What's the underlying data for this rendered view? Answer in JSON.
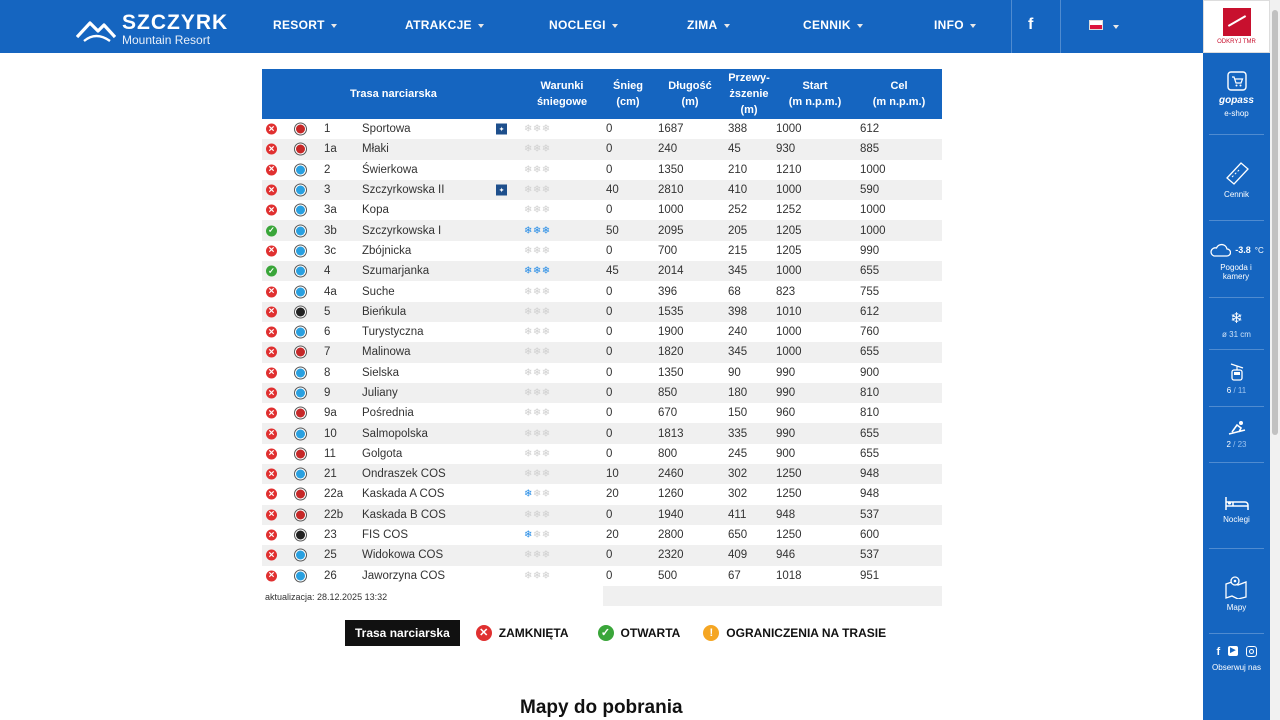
{
  "brand": {
    "title": "SZCZYRK",
    "subtitle": "Mountain Resort"
  },
  "nav": [
    "RESORT",
    "ATRAKCJE",
    "NOCLEGI",
    "ZIMA",
    "CENNIK",
    "INFO"
  ],
  "sidebar": {
    "brand_caption": "ODKRYJ TMR",
    "gopass": {
      "logo": "gopass",
      "label": "e-shop"
    },
    "cennik": "Cennik",
    "weather": {
      "temp": "-3.8",
      "unit": "°C",
      "label": "Pogoda i kamery"
    },
    "snow": "ø 31 cm",
    "lifts": {
      "open": "6",
      "total": "11"
    },
    "slopes": {
      "open": "2",
      "total": "23"
    },
    "noclegi": "Noclegi",
    "mapy": "Mapy",
    "follow": "Obserwuj nas"
  },
  "table": {
    "headers": {
      "trail": "Trasa narciarska",
      "conditions_1": "Warunki",
      "conditions_2": "śniegowe",
      "snow_1": "Śnieg",
      "snow_2": "(cm)",
      "length_1": "Długość",
      "length_2": "(m)",
      "drop_1": "Przewy-",
      "drop_2": "ższenie",
      "drop_3": "(m)",
      "start_1": "Start",
      "start_2": "(m n.p.m.)",
      "end_1": "Cel",
      "end_2": "(m n.p.m.)"
    },
    "rows": [
      {
        "status": "closed",
        "difficulty": "red",
        "num": "1",
        "name": "Sportowa",
        "lamp": true,
        "flakes": 0,
        "snow": "0",
        "length": "1687",
        "drop": "388",
        "start": "1000",
        "end": "612"
      },
      {
        "status": "closed",
        "difficulty": "red",
        "num": "1a",
        "name": "Młaki",
        "lamp": false,
        "flakes": 0,
        "snow": "0",
        "length": "240",
        "drop": "45",
        "start": "930",
        "end": "885"
      },
      {
        "status": "closed",
        "difficulty": "blue",
        "num": "2",
        "name": "Świerkowa",
        "lamp": false,
        "flakes": 0,
        "snow": "0",
        "length": "1350",
        "drop": "210",
        "start": "1210",
        "end": "1000"
      },
      {
        "status": "closed",
        "difficulty": "blue",
        "num": "3",
        "name": "Szczyrkowska II",
        "lamp": true,
        "flakes": 0,
        "snow": "40",
        "length": "2810",
        "drop": "410",
        "start": "1000",
        "end": "590"
      },
      {
        "status": "closed",
        "difficulty": "blue",
        "num": "3a",
        "name": "Kopa",
        "lamp": false,
        "flakes": 0,
        "snow": "0",
        "length": "1000",
        "drop": "252",
        "start": "1252",
        "end": "1000"
      },
      {
        "status": "open",
        "difficulty": "blue",
        "num": "3b",
        "name": "Szczyrkowska I",
        "lamp": false,
        "flakes": 3,
        "snow": "50",
        "length": "2095",
        "drop": "205",
        "start": "1205",
        "end": "1000"
      },
      {
        "status": "closed",
        "difficulty": "blue",
        "num": "3c",
        "name": "Zbójnicka",
        "lamp": false,
        "flakes": 0,
        "snow": "0",
        "length": "700",
        "drop": "215",
        "start": "1205",
        "end": "990"
      },
      {
        "status": "open",
        "difficulty": "blue",
        "num": "4",
        "name": "Szumarjanka",
        "lamp": false,
        "flakes": 3,
        "snow": "45",
        "length": "2014",
        "drop": "345",
        "start": "1000",
        "end": "655"
      },
      {
        "status": "closed",
        "difficulty": "blue",
        "num": "4a",
        "name": "Suche",
        "lamp": false,
        "flakes": 0,
        "snow": "0",
        "length": "396",
        "drop": "68",
        "start": "823",
        "end": "755"
      },
      {
        "status": "closed",
        "difficulty": "black",
        "num": "5",
        "name": "Bieńkula",
        "lamp": false,
        "flakes": 0,
        "snow": "0",
        "length": "1535",
        "drop": "398",
        "start": "1010",
        "end": "612"
      },
      {
        "status": "closed",
        "difficulty": "blue",
        "num": "6",
        "name": "Turystyczna",
        "lamp": false,
        "flakes": 0,
        "snow": "0",
        "length": "1900",
        "drop": "240",
        "start": "1000",
        "end": "760"
      },
      {
        "status": "closed",
        "difficulty": "red",
        "num": "7",
        "name": "Malinowa",
        "lamp": false,
        "flakes": 0,
        "snow": "0",
        "length": "1820",
        "drop": "345",
        "start": "1000",
        "end": "655"
      },
      {
        "status": "closed",
        "difficulty": "blue",
        "num": "8",
        "name": "Sielska",
        "lamp": false,
        "flakes": 0,
        "snow": "0",
        "length": "1350",
        "drop": "90",
        "start": "990",
        "end": "900"
      },
      {
        "status": "closed",
        "difficulty": "blue",
        "num": "9",
        "name": "Juliany",
        "lamp": false,
        "flakes": 0,
        "snow": "0",
        "length": "850",
        "drop": "180",
        "start": "990",
        "end": "810"
      },
      {
        "status": "closed",
        "difficulty": "red",
        "num": "9a",
        "name": "Pośrednia",
        "lamp": false,
        "flakes": 0,
        "snow": "0",
        "length": "670",
        "drop": "150",
        "start": "960",
        "end": "810"
      },
      {
        "status": "closed",
        "difficulty": "blue",
        "num": "10",
        "name": "Salmopolska",
        "lamp": false,
        "flakes": 0,
        "snow": "0",
        "length": "1813",
        "drop": "335",
        "start": "990",
        "end": "655"
      },
      {
        "status": "closed",
        "difficulty": "red",
        "num": "11",
        "name": "Golgota",
        "lamp": false,
        "flakes": 0,
        "snow": "0",
        "length": "800",
        "drop": "245",
        "start": "900",
        "end": "655"
      },
      {
        "status": "closed",
        "difficulty": "blue",
        "num": "21",
        "name": "Ondraszek COS",
        "lamp": false,
        "flakes": 0,
        "snow": "10",
        "length": "2460",
        "drop": "302",
        "start": "1250",
        "end": "948"
      },
      {
        "status": "closed",
        "difficulty": "red",
        "num": "22a",
        "name": "Kaskada A COS",
        "lamp": false,
        "flakes": 1,
        "snow": "20",
        "length": "1260",
        "drop": "302",
        "start": "1250",
        "end": "948"
      },
      {
        "status": "closed",
        "difficulty": "red",
        "num": "22b",
        "name": "Kaskada B COS",
        "lamp": false,
        "flakes": 0,
        "snow": "0",
        "length": "1940",
        "drop": "411",
        "start": "948",
        "end": "537"
      },
      {
        "status": "closed",
        "difficulty": "black",
        "num": "23",
        "name": "FIS COS",
        "lamp": false,
        "flakes": 1,
        "snow": "20",
        "length": "2800",
        "drop": "650",
        "start": "1250",
        "end": "600"
      },
      {
        "status": "closed",
        "difficulty": "blue",
        "num": "25",
        "name": "Widokowa COS",
        "lamp": false,
        "flakes": 0,
        "snow": "0",
        "length": "2320",
        "drop": "409",
        "start": "946",
        "end": "537"
      },
      {
        "status": "closed",
        "difficulty": "blue",
        "num": "26",
        "name": "Jaworzyna COS",
        "lamp": false,
        "flakes": 0,
        "snow": "0",
        "length": "500",
        "drop": "67",
        "start": "1018",
        "end": "951"
      }
    ],
    "updated": "aktualizacja: 28.12.2025 13:32"
  },
  "legend": {
    "trail": "Trasa narciarska",
    "closed": "ZAMKNIĘTA",
    "open": "OTWARTA",
    "restricted": "OGRANICZENIA NA TRASIE"
  },
  "maps_title": "Mapy do pobrania",
  "colors": {
    "primary": "#1565c0",
    "red": "#c62828",
    "blue": "#29a0e0",
    "black": "#222222",
    "closed": "#e03030",
    "open": "#3aa63a",
    "warn": "#f5a623"
  }
}
